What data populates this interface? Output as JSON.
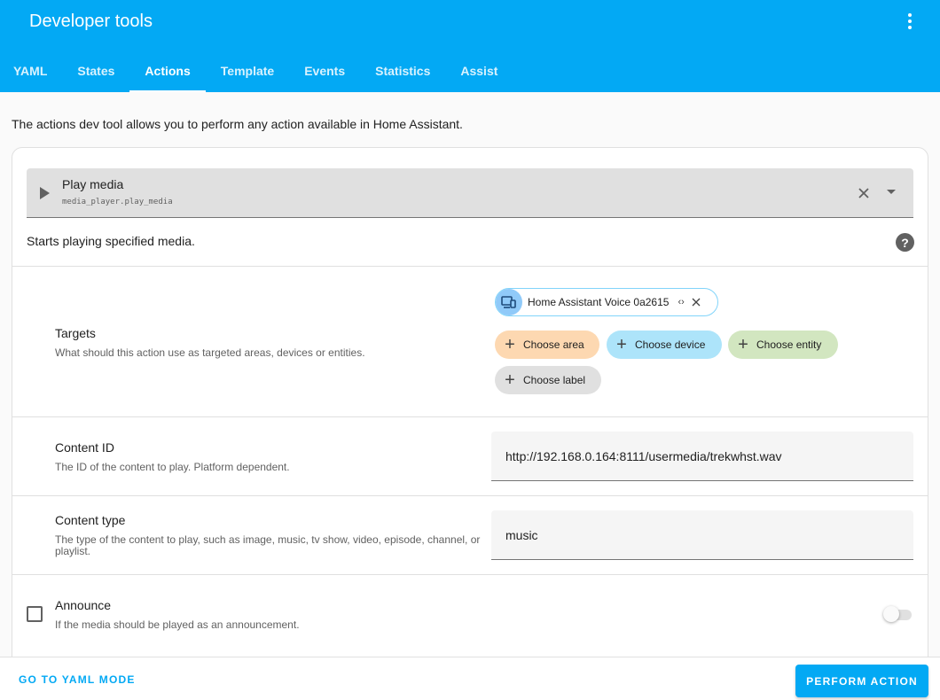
{
  "header": {
    "title": "Developer tools",
    "tabs": [
      {
        "label": "YAML",
        "active": false
      },
      {
        "label": "States",
        "active": false
      },
      {
        "label": "Actions",
        "active": true
      },
      {
        "label": "Template",
        "active": false
      },
      {
        "label": "Events",
        "active": false
      },
      {
        "label": "Statistics",
        "active": false
      },
      {
        "label": "Assist",
        "active": false
      }
    ]
  },
  "intro": "The actions dev tool allows you to perform any action available in Home Assistant.",
  "action": {
    "name": "Play media",
    "id": "media_player.play_media",
    "description": "Starts playing specified media.",
    "help_symbol": "?"
  },
  "targets": {
    "label": "Targets",
    "help": "What should this action use as targeted areas, devices or entities.",
    "selected": "Home Assistant Voice 0a2615",
    "expand_symbol": "‹›",
    "chips": {
      "area": "Choose area",
      "device": "Choose device",
      "entity": "Choose entity",
      "label": "Choose label"
    },
    "plus_symbol": "+"
  },
  "content_id": {
    "label": "Content ID",
    "help": "The ID of the content to play. Platform dependent.",
    "value": "http://192.168.0.164:8111/usermedia/trekwhst.wav"
  },
  "content_type": {
    "label": "Content type",
    "help": "The type of the content to play, such as image, music, tv show, video, episode, channel, or playlist.",
    "value": "music"
  },
  "announce": {
    "label": "Announce",
    "help": "If the media should be played as an announcement.",
    "checked": false,
    "enabled": false
  },
  "footer": {
    "yaml_mode": "GO TO YAML MODE",
    "perform": "PERFORM ACTION"
  },
  "colors": {
    "primary": "#03a9f4",
    "area_chip": "#fdd8b1",
    "device_chip": "#ade4fa",
    "entity_chip": "#d2e6c0",
    "label_chip": "#e0e0e0"
  },
  "icons": {
    "menu": "dots-vertical-icon",
    "play": "play-icon",
    "clear": "close-icon",
    "dropdown": "menu-down-icon",
    "help": "help-circle-icon",
    "device": "devices-icon"
  }
}
